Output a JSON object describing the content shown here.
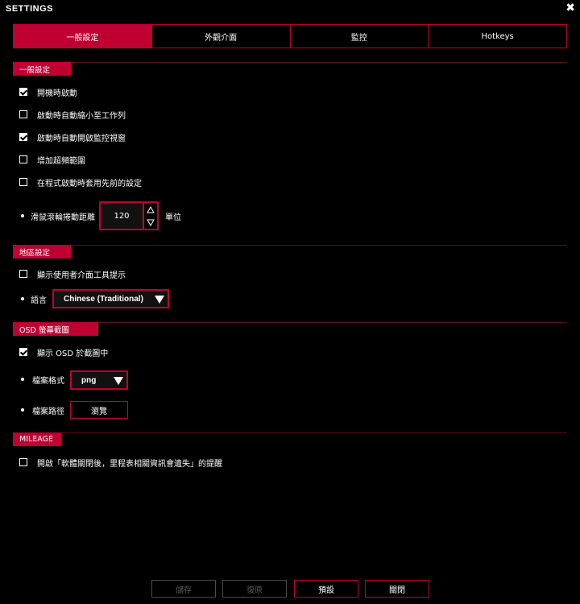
{
  "window": {
    "title": "SETTINGS",
    "close_glyph": "✖"
  },
  "tabs": [
    {
      "label": "一般設定",
      "active": true
    },
    {
      "label": "外觀介面",
      "active": false
    },
    {
      "label": "監控",
      "active": false
    },
    {
      "label": "Hotkeys",
      "active": false
    }
  ],
  "general": {
    "header": "一般設定",
    "options": [
      {
        "label": "開機時啟動",
        "checked": true
      },
      {
        "label": "啟動時自動縮小至工作列",
        "checked": false
      },
      {
        "label": "啟動時自動開啟監控視窗",
        "checked": true
      },
      {
        "label": "增加超頻範圍",
        "checked": false
      },
      {
        "label": "在程式啟動時套用先前的設定",
        "checked": false
      }
    ],
    "scroll": {
      "label": "滑鼠滾輪捲動距離",
      "value": "120",
      "unit": "單位"
    }
  },
  "region": {
    "header": "地區設定",
    "tooltip_option": {
      "label": "顯示使用者介面工具提示",
      "checked": false
    },
    "language_label": "語言",
    "language_value": "Chinese (Traditional)"
  },
  "osd": {
    "header": "OSD 螢幕截圖",
    "show_osd": {
      "label": "顯示 OSD 於截圖中",
      "checked": true
    },
    "format_label": "檔案格式",
    "format_value": "png",
    "path_label": "檔案路徑",
    "browse_label": "瀏覽"
  },
  "mileage": {
    "header": "MILEAGE",
    "option": {
      "label": "開啟「軟體關閉後，里程表相關資訊會遺失」的提醒",
      "checked": false
    }
  },
  "footer": {
    "save": "儲存",
    "restore": "復原",
    "default": "預設",
    "close": "關閉"
  },
  "colors": {
    "accent": "#c10032",
    "background": "#000000",
    "text": "#ffffff",
    "disabled": "#5a5a5a"
  },
  "icons": {
    "close": "close-icon",
    "checkbox_checked": "checkmark-icon",
    "dropdown": "triangle-down-icon",
    "stepper_up": "triangle-up-icon",
    "stepper_down": "triangle-down-icon"
  }
}
